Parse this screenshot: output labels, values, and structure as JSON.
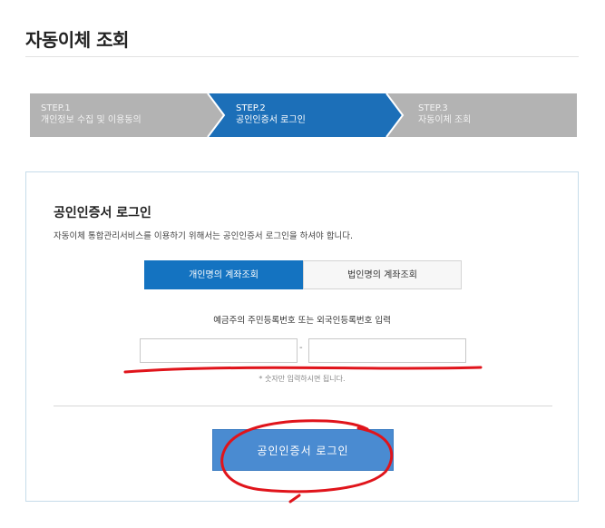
{
  "page": {
    "title": "자동이체 조회"
  },
  "steps": [
    {
      "number": "STEP.1",
      "label": "개인정보 수집 및 이용동의",
      "state": "done",
      "color": "#b3b3b3"
    },
    {
      "number": "STEP.2",
      "label": "공인인증서 로그인",
      "state": "active",
      "color": "#1c6fb8"
    },
    {
      "number": "STEP.3",
      "label": "자동이체 조회",
      "state": "pending",
      "color": "#b3b3b3"
    }
  ],
  "login": {
    "title": "공인인증서 로그인",
    "description": "자동이체 통합관리서비스를 이용하기 위해서는 공인인증서 로그인을 하셔야 합니다.",
    "tabs": [
      {
        "label": "개인명의 계좌조회",
        "selected": true
      },
      {
        "label": "법인명의 계좌조회",
        "selected": false
      }
    ],
    "id_label": "예금주의 주민등록번호 또는 외국인등록번호 입력",
    "id_front_value": "",
    "id_back_value": "",
    "separator": "-",
    "hint": "* 숫자만 입력하시면 됩니다.",
    "button_label": "공인인증서 로그인"
  },
  "colors": {
    "accent": "#1473c1",
    "button": "#4a8bd1",
    "annotation": "#e0141b"
  }
}
